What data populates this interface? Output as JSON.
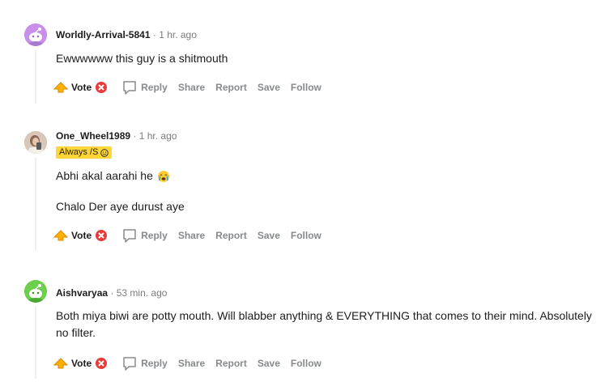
{
  "comments": [
    {
      "username": "Worldly-Arrival-5841",
      "separator": "·",
      "time": "1 hr. ago",
      "avatar": "snoo-avatar-purple",
      "flair": null,
      "lines": [
        "Ewwwwww this guy is a shitmouth"
      ],
      "actions": {
        "vote": "Vote",
        "reply": "Reply",
        "share": "Share",
        "report": "Report",
        "save": "Save",
        "follow": "Follow"
      }
    },
    {
      "username": "One_Wheel1989",
      "separator": "·",
      "time": "1 hr. ago",
      "avatar": "photo-avatar",
      "flair": "Always /S",
      "lines": [
        "Abhi akal aarahi he",
        "Chalo Der aye durust aye"
      ],
      "actions": {
        "vote": "Vote",
        "reply": "Reply",
        "share": "Share",
        "report": "Report",
        "save": "Save",
        "follow": "Follow"
      }
    },
    {
      "username": "Aishvaryaa",
      "separator": "·",
      "time": "53 min. ago",
      "avatar": "snoo-avatar-green",
      "flair": null,
      "lines": [
        "Both miya biwi are potty mouth. Will blabber anything & EVERYTHING that comes to their mind. Absolutely no filter."
      ],
      "actions": {
        "vote": "Vote",
        "reply": "Reply",
        "share": "Share",
        "report": "Report",
        "save": "Save",
        "follow": "Follow"
      }
    }
  ],
  "colors": {
    "flair_bg": "#ffd635",
    "vote_icon": "#ffb000",
    "downvote_icon": "#ea3a3a",
    "muted": "#878a8c"
  }
}
